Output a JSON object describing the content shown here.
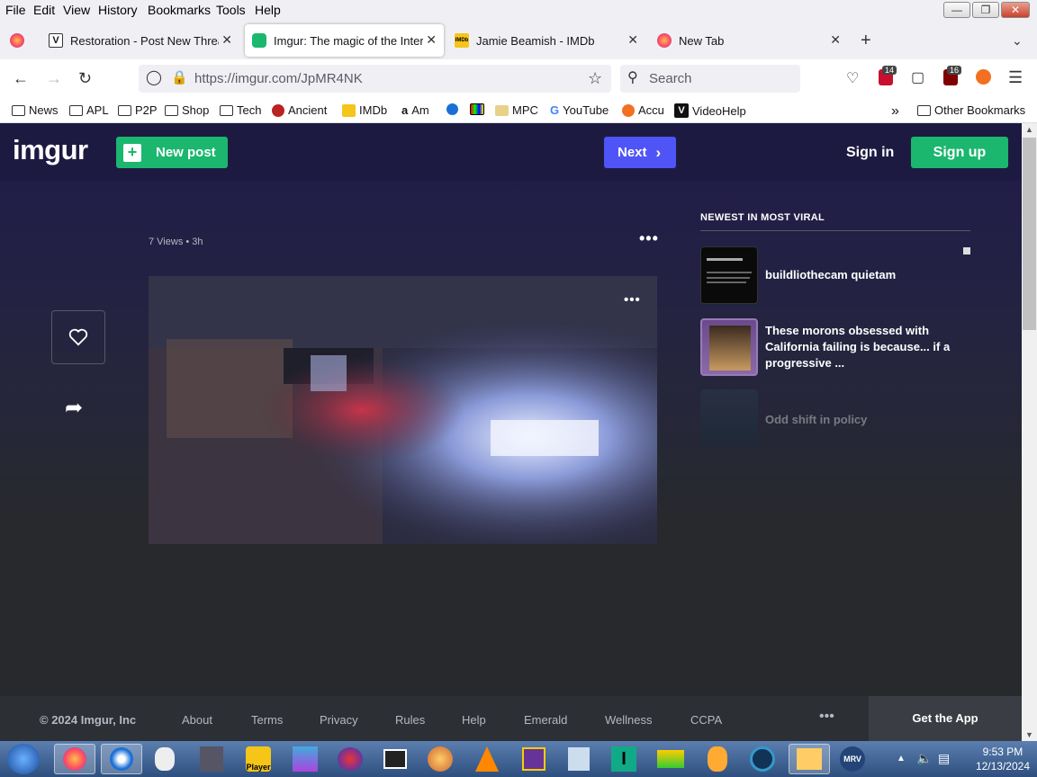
{
  "menu": [
    "File",
    "Edit",
    "View",
    "History",
    "Bookmarks",
    "Tools",
    "Help"
  ],
  "menu_underline": [
    "F",
    "E",
    "V",
    "s",
    "B",
    "T",
    "H"
  ],
  "tabs": [
    {
      "title": "Restoration - Post New Thread",
      "color": "#ffffff"
    },
    {
      "title": "Imgur: The magic of the Internet",
      "color": "#1bb76e"
    },
    {
      "title": "Jamie Beamish - IMDb",
      "color": "#f5c518"
    },
    {
      "title": "New Tab",
      "color": "#ff7139"
    }
  ],
  "url": "https://imgur.com/JpMR4NK",
  "search_placeholder": "Search",
  "badges": {
    "ublock": "14",
    "other": "16"
  },
  "bookmarks": [
    "News",
    "APL",
    "P2P",
    "Shop",
    "Tech",
    "Ancient",
    "IMDb",
    "Am",
    "",
    "",
    "MPC",
    "YouTube",
    "Accu",
    "VideoHelp"
  ],
  "other_bookmarks": "Other Bookmarks",
  "imgur": {
    "logo": "imgur",
    "new_post": "New post",
    "next": "Next",
    "sign_in": "Sign in",
    "sign_up": "Sign up",
    "meta": "7 Views • 3h",
    "sidebar_heading": "NEWEST IN MOST VIRAL",
    "cards": [
      {
        "title": "buildliothecam quietam"
      },
      {
        "title": "These morons obsessed with California failing is because... if a progressive ..."
      },
      {
        "title": "Odd shift in policy"
      }
    ]
  },
  "footer": {
    "copyright": "© 2024 Imgur, Inc",
    "links": [
      "About",
      "Terms",
      "Privacy",
      "Rules",
      "Help",
      "Emerald",
      "Wellness",
      "CCPA"
    ],
    "get_app": "Get the App"
  },
  "taskbar": {
    "time": "9:53 PM",
    "date": "12/13/2024",
    "player_label": "Player"
  },
  "colors": {
    "imgur_green": "#1bb76e",
    "imgur_blue": "#4f54f7",
    "header_bg": "#1d1a42"
  }
}
